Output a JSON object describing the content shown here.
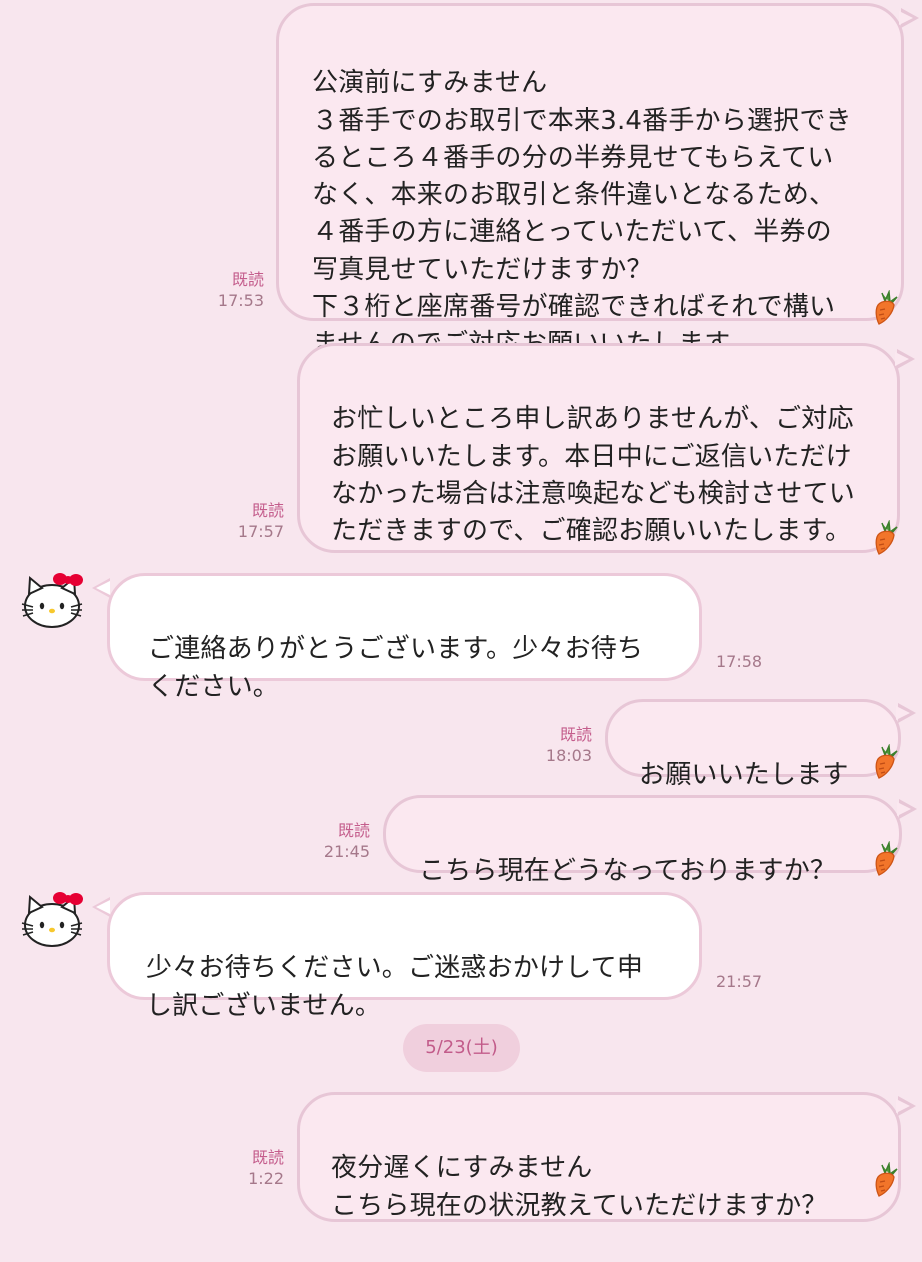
{
  "colors": {
    "background": "#f8e6ee",
    "sent_bubble": "#fbe8f0",
    "sent_border": "#e7c6d6",
    "recv_bubble": "#ffffff",
    "read_text": "#c45d8c",
    "time_text": "#a5788a",
    "date_pill": "#f0cfdd"
  },
  "messages": [
    {
      "side": "sent",
      "text": "公演前にすみません\n３番手でのお取引で本来3.4番手から選択できるところ４番手の分の半券見せてもらえていなく、本来のお取引と条件違いとなるため、４番手の方に連絡とっていただいて、半券の写真見せていただけますか？\n下３桁と座席番号が確認できればそれで構いませんのでご対応お願いいたします。",
      "read": "既読",
      "time": "17:53",
      "icon": "carrot-icon"
    },
    {
      "side": "sent",
      "text": "お忙しいところ申し訳ありませんが、ご対応お願いいたします。本日中にご返信いただけなかった場合は注意喚起なども検討させていただきますので、ご確認お願いいたします。",
      "read": "既読",
      "time": "17:57",
      "icon": "carrot-icon"
    },
    {
      "side": "recv",
      "text": "ご連絡ありがとうございます。少々お待ちください。",
      "time": "17:58",
      "avatar": "hello-kitty-avatar"
    },
    {
      "side": "sent",
      "text": "お願いいたします",
      "read": "既読",
      "time": "18:03",
      "icon": "carrot-icon"
    },
    {
      "side": "sent",
      "text": "こちら現在どうなっておりますか？",
      "read": "既読",
      "time": "21:45",
      "icon": "carrot-icon"
    },
    {
      "side": "recv",
      "text": "少々お待ちください。ご迷惑おかけして申し訳ございません。",
      "time": "21:57",
      "avatar": "hello-kitty-avatar"
    },
    {
      "side": "sent",
      "text": "夜分遅くにすみません\nこちら現在の状況教えていただけますか？",
      "read": "既読",
      "time": "1:22",
      "icon": "carrot-icon"
    }
  ],
  "date_separator": "5/23(土)"
}
